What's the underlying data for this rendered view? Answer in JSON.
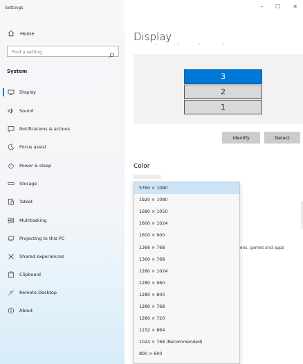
{
  "window": {
    "title": "Settings",
    "controls": [
      "–",
      "☐",
      "✕"
    ]
  },
  "sidebar": {
    "home_label": "Home",
    "search_placeholder": "Find a setting",
    "section_label": "System",
    "items": [
      {
        "label": "Display",
        "icon": "monitor-icon",
        "active": true
      },
      {
        "label": "Sound",
        "icon": "speaker-icon"
      },
      {
        "label": "Notifications & actions",
        "icon": "notification-icon"
      },
      {
        "label": "Focus assist",
        "icon": "moon-icon"
      },
      {
        "label": "Power & sleep",
        "icon": "power-icon"
      },
      {
        "label": "Storage",
        "icon": "storage-icon"
      },
      {
        "label": "Tablet",
        "icon": "tablet-icon"
      },
      {
        "label": "Multitasking",
        "icon": "multitasking-icon"
      },
      {
        "label": "Projecting to this PC",
        "icon": "projecting-icon"
      },
      {
        "label": "Shared experiences",
        "icon": "shared-icon"
      },
      {
        "label": "Clipboard",
        "icon": "clipboard-icon"
      },
      {
        "label": "Remote Desktop",
        "icon": "remote-desktop-icon"
      },
      {
        "label": "About",
        "icon": "info-icon"
      }
    ]
  },
  "main": {
    "title": "Display",
    "monitors": [
      {
        "label": "3",
        "selected": true
      },
      {
        "label": "2",
        "selected": false
      },
      {
        "label": "1",
        "selected": false
      }
    ],
    "identify_label": "Identify",
    "detect_label": "Detect",
    "color_heading": "Color",
    "side_text": "deos, games and apps"
  },
  "resolution_dropdown": {
    "selected": "5760 × 1080",
    "options": [
      "5760 × 1080",
      "1920 × 1080",
      "1680 × 1050",
      "1600 × 1024",
      "1600 × 900",
      "1366 × 768",
      "1360 × 768",
      "1280 × 1024",
      "1280 × 960",
      "1280 × 800",
      "1280 × 768",
      "1280 × 720",
      "1152 × 864",
      "1024 × 768 (Recommended)",
      "800 × 600"
    ]
  },
  "colors": {
    "accent": "#0078d7",
    "dropdown_selected": "#cce4f7"
  }
}
